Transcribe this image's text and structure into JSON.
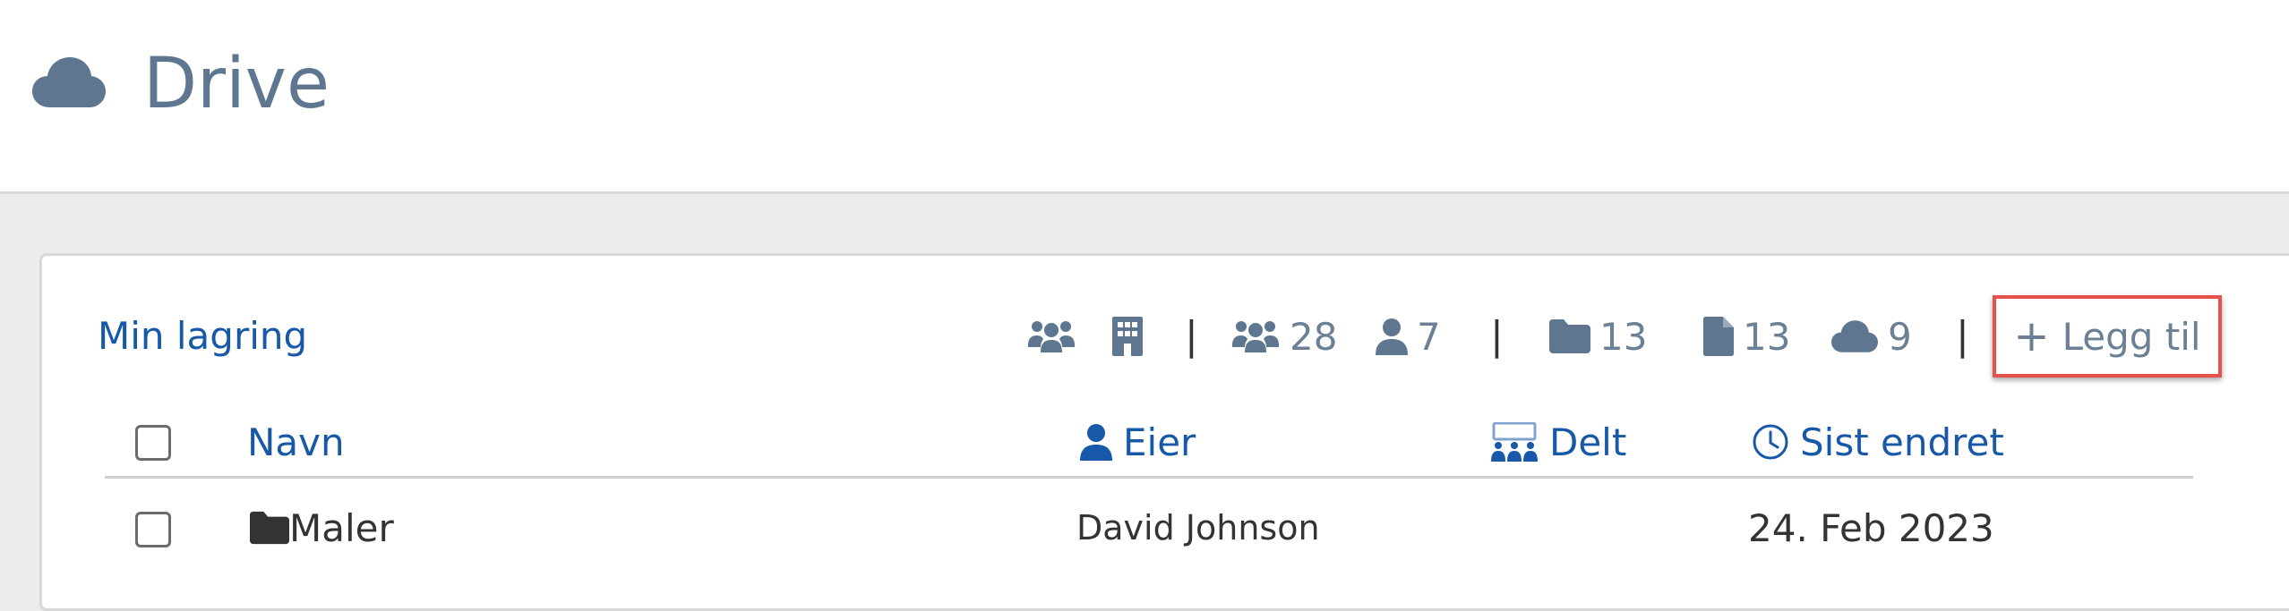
{
  "header": {
    "app_icon": "cloud-icon",
    "title": "Drive"
  },
  "toolbar": {
    "storage_title": "Min lagring",
    "stats": {
      "group_icon": "users-icon",
      "building_icon": "building-icon",
      "shared_users": "28",
      "single_users": "7",
      "folders": "13",
      "files": "13",
      "cloud": "9"
    },
    "separator": "|",
    "add_icon": "plus-icon",
    "add_label": "Legg til"
  },
  "table": {
    "columns": {
      "name": "Navn",
      "owner": "Eier",
      "shared": "Delt",
      "modified": "Sist endret"
    },
    "rows": [
      {
        "icon": "folder-icon",
        "name": "Maler",
        "owner": "David Johnson",
        "modified": "24. Feb 2023"
      }
    ]
  },
  "colors": {
    "accent": "#1759a8",
    "muted_icon": "#5f7690",
    "highlight_border": "#e5524a"
  }
}
